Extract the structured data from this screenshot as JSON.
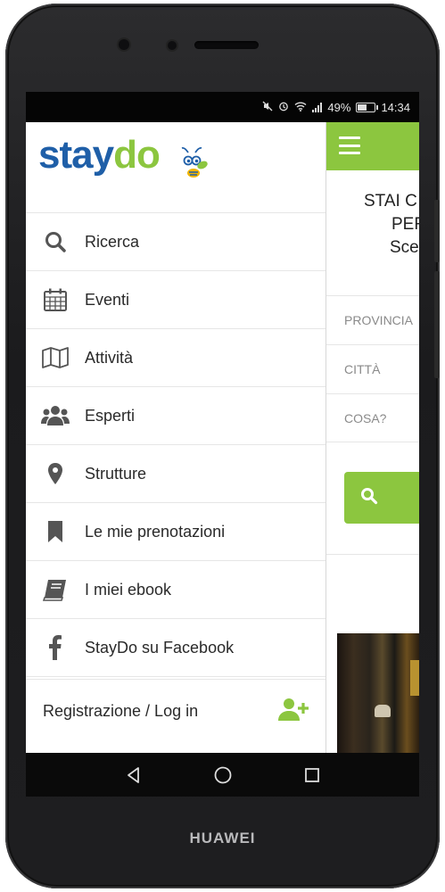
{
  "device": {
    "brand": "HUAWEI"
  },
  "status_bar": {
    "battery": "49%",
    "battery_level": 0.49,
    "time": "14:34",
    "icons": [
      "mute-icon",
      "alarm-icon",
      "wifi-icon",
      "signal-icon",
      "battery-icon"
    ]
  },
  "drawer": {
    "logo": {
      "stay": "stay",
      "do": "do"
    },
    "items": [
      {
        "label": "Ricerca",
        "icon": "search-icon"
      },
      {
        "label": "Eventi",
        "icon": "calendar-icon"
      },
      {
        "label": "Attività",
        "icon": "map-icon"
      },
      {
        "label": "Esperti",
        "icon": "group-icon"
      },
      {
        "label": "Strutture",
        "icon": "location-pin-icon"
      },
      {
        "label": "Le mie prenotazioni",
        "icon": "bookmark-icon"
      },
      {
        "label": "I miei ebook",
        "icon": "book-icon"
      },
      {
        "label": "StayDo su Facebook",
        "icon": "facebook-icon"
      }
    ],
    "register": {
      "label": "Registrazione / Log in",
      "icon": "add-user-icon"
    }
  },
  "app": {
    "hero": {
      "line1": "STAI C",
      "line2": "PEF",
      "line3": "Sce"
    },
    "fields": {
      "province": "PROVINCIA",
      "city": "CITTÀ",
      "what": "COSA?"
    }
  },
  "colors": {
    "brand_green": "#8cc63f",
    "brand_blue": "#1f5fa8",
    "icon_gray": "#555555"
  }
}
